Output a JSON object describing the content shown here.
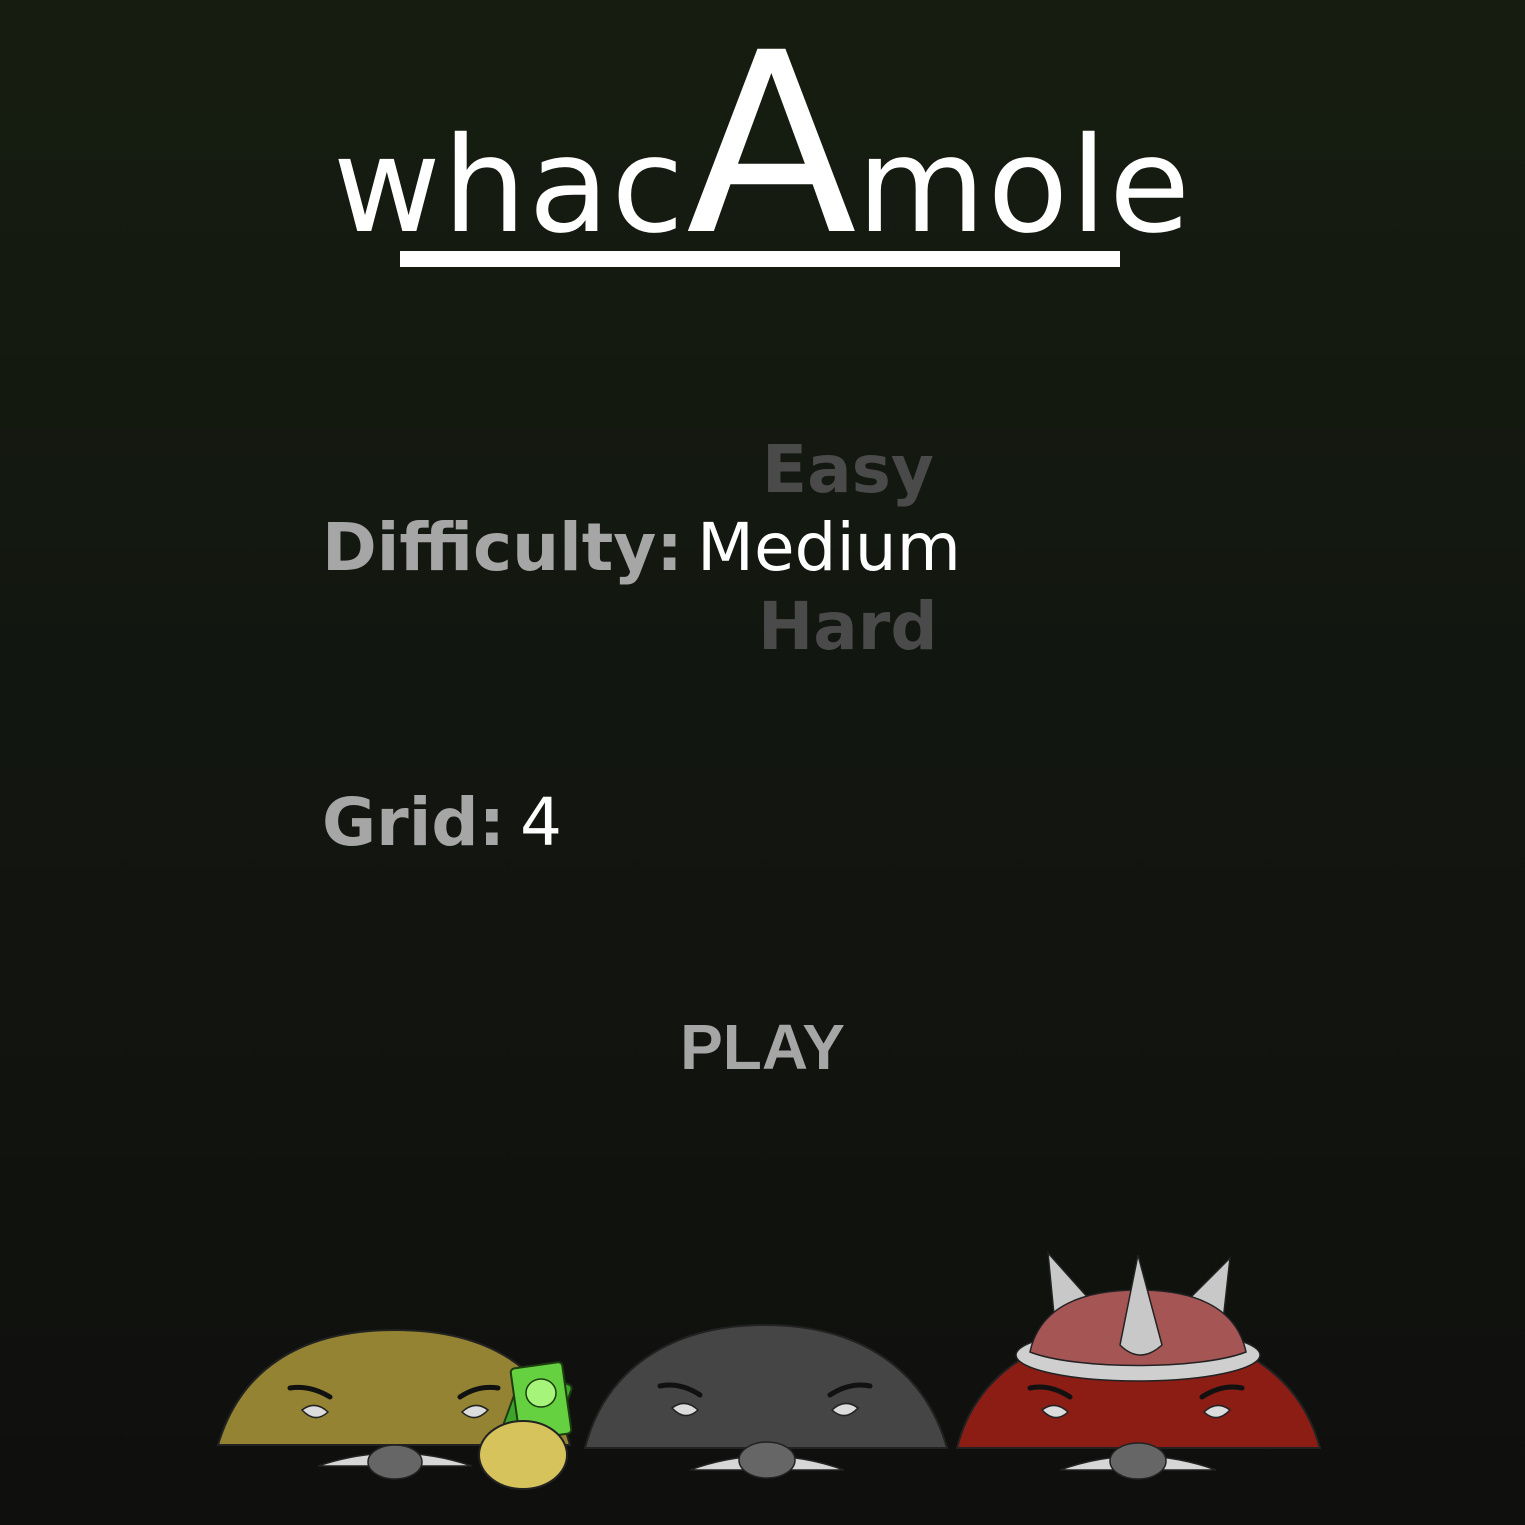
{
  "title": {
    "part1": "whac",
    "part2": "A",
    "part3": "mole"
  },
  "difficulty": {
    "label": "Difficulty:",
    "options": [
      "Easy",
      "Medium",
      "Hard"
    ],
    "selected": "Medium"
  },
  "grid": {
    "label": "Grid:",
    "value": "4"
  },
  "play_label": "PLAY",
  "colors": {
    "background": "#141910",
    "title": "#ffffff",
    "label": "#a6a6a6",
    "dim_option": "#4a4a4a",
    "mole_gold": "#948332",
    "mole_gray": "#454545",
    "mole_red": "#8b1d15"
  }
}
